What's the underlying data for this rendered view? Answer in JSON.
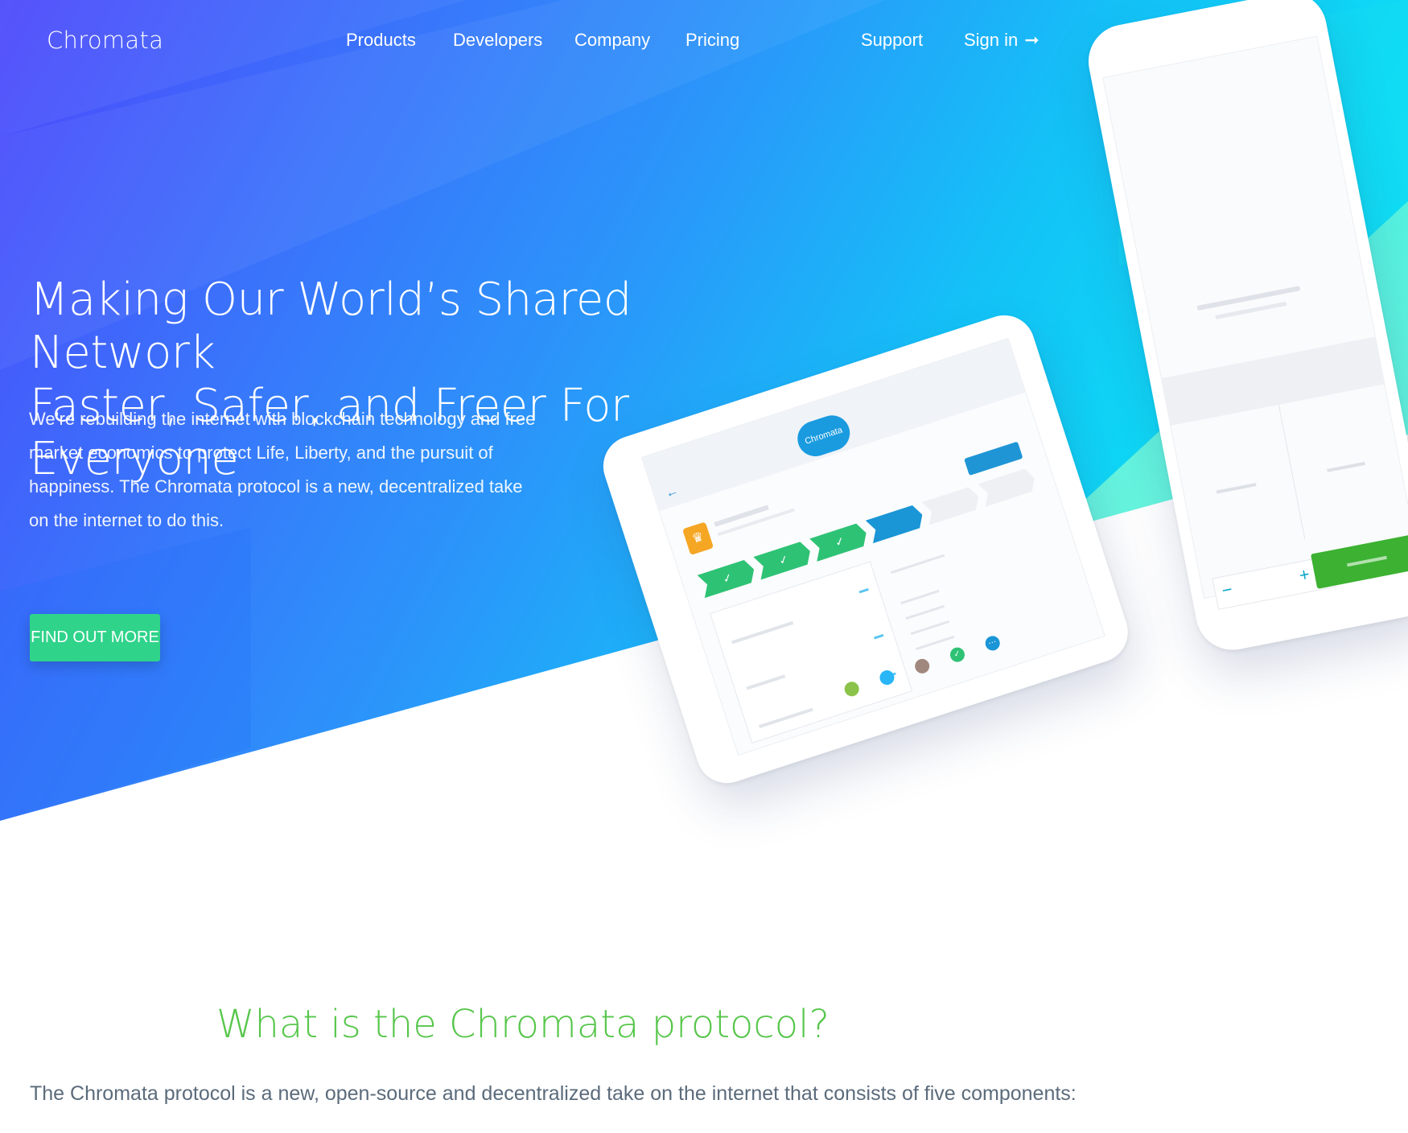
{
  "nav": {
    "brand": "Chromata",
    "links": [
      "Products",
      "Developers",
      "Company",
      "Pricing"
    ],
    "support": "Support",
    "signin": "Sign in",
    "signin_arrow": "➞"
  },
  "hero": {
    "title_line1": "Making Our World’s Shared Network",
    "title_line2": "Faster, Safer, and Freer For Everyone",
    "description": "We’re rebuilding the internet with blockchain technology and free market economics to protect Life, Liberty, and the pursuit of happiness. The Chromata protocol is a new, decentralized take on the internet to do this.",
    "cta": "FIND OUT MORE"
  },
  "mockup": {
    "tablet_logo": "Chromata",
    "back_icon": "arrow-left-icon",
    "crown_icon": "crown-icon",
    "step_check": "✓",
    "phone_minus": "−",
    "phone_plus": "+"
  },
  "section": {
    "title": "What is the Chromata protocol?",
    "text": "The Chromata protocol is a new, open-source and decentralized take on the internet that consists of five components:"
  },
  "colors": {
    "gradient_start": "#4c48fb",
    "gradient_end": "#17e2f0",
    "cta": "#2fd38a",
    "section_title": "#57c64b"
  }
}
